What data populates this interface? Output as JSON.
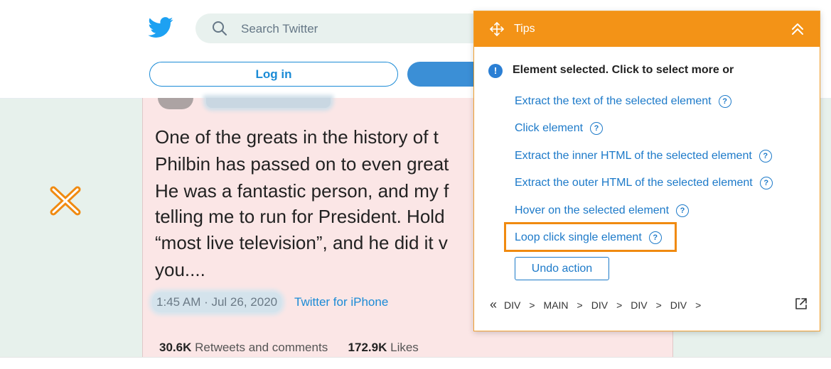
{
  "twitter": {
    "search_placeholder": "Search Twitter",
    "login_label": "Log in",
    "brand_color": "#1da1f2"
  },
  "tweet": {
    "lines": [
      "One of the greats in the history of t",
      "Philbin has passed on to even great",
      "He was a fantastic person, and my f",
      "telling me to run for President. Hold",
      "“most live television”, and he did it v",
      "you...."
    ],
    "time": "1:45 AM · Jul 26, 2020",
    "source": "Twitter for iPhone",
    "retweets_count": "30.6K",
    "retweets_label": "Retweets and comments",
    "likes_count": "172.9K",
    "likes_label": "Likes"
  },
  "tips": {
    "title": "Tips",
    "heading": "Element selected. Click to select more or",
    "actions": [
      "Extract the text of the selected element",
      "Click element",
      "Extract the inner HTML of the selected element",
      "Extract the outer HTML of the selected element",
      "Hover on the selected element",
      "Loop click single element"
    ],
    "undo_label": "Undo action",
    "breadcrumb": [
      "DIV",
      "MAIN",
      "DIV",
      "DIV",
      "DIV"
    ],
    "accent_color": "#f39317",
    "link_color": "#1d7ac9"
  },
  "icons": {
    "bird": "twitter-bird-icon",
    "search": "search-icon",
    "move": "move-icon",
    "collapse": "chevron-double-up-icon",
    "info": "info-icon",
    "help": "question-circle-icon",
    "back": "double-chevron-left-icon",
    "external": "external-link-icon",
    "close": "orange-x-icon"
  }
}
